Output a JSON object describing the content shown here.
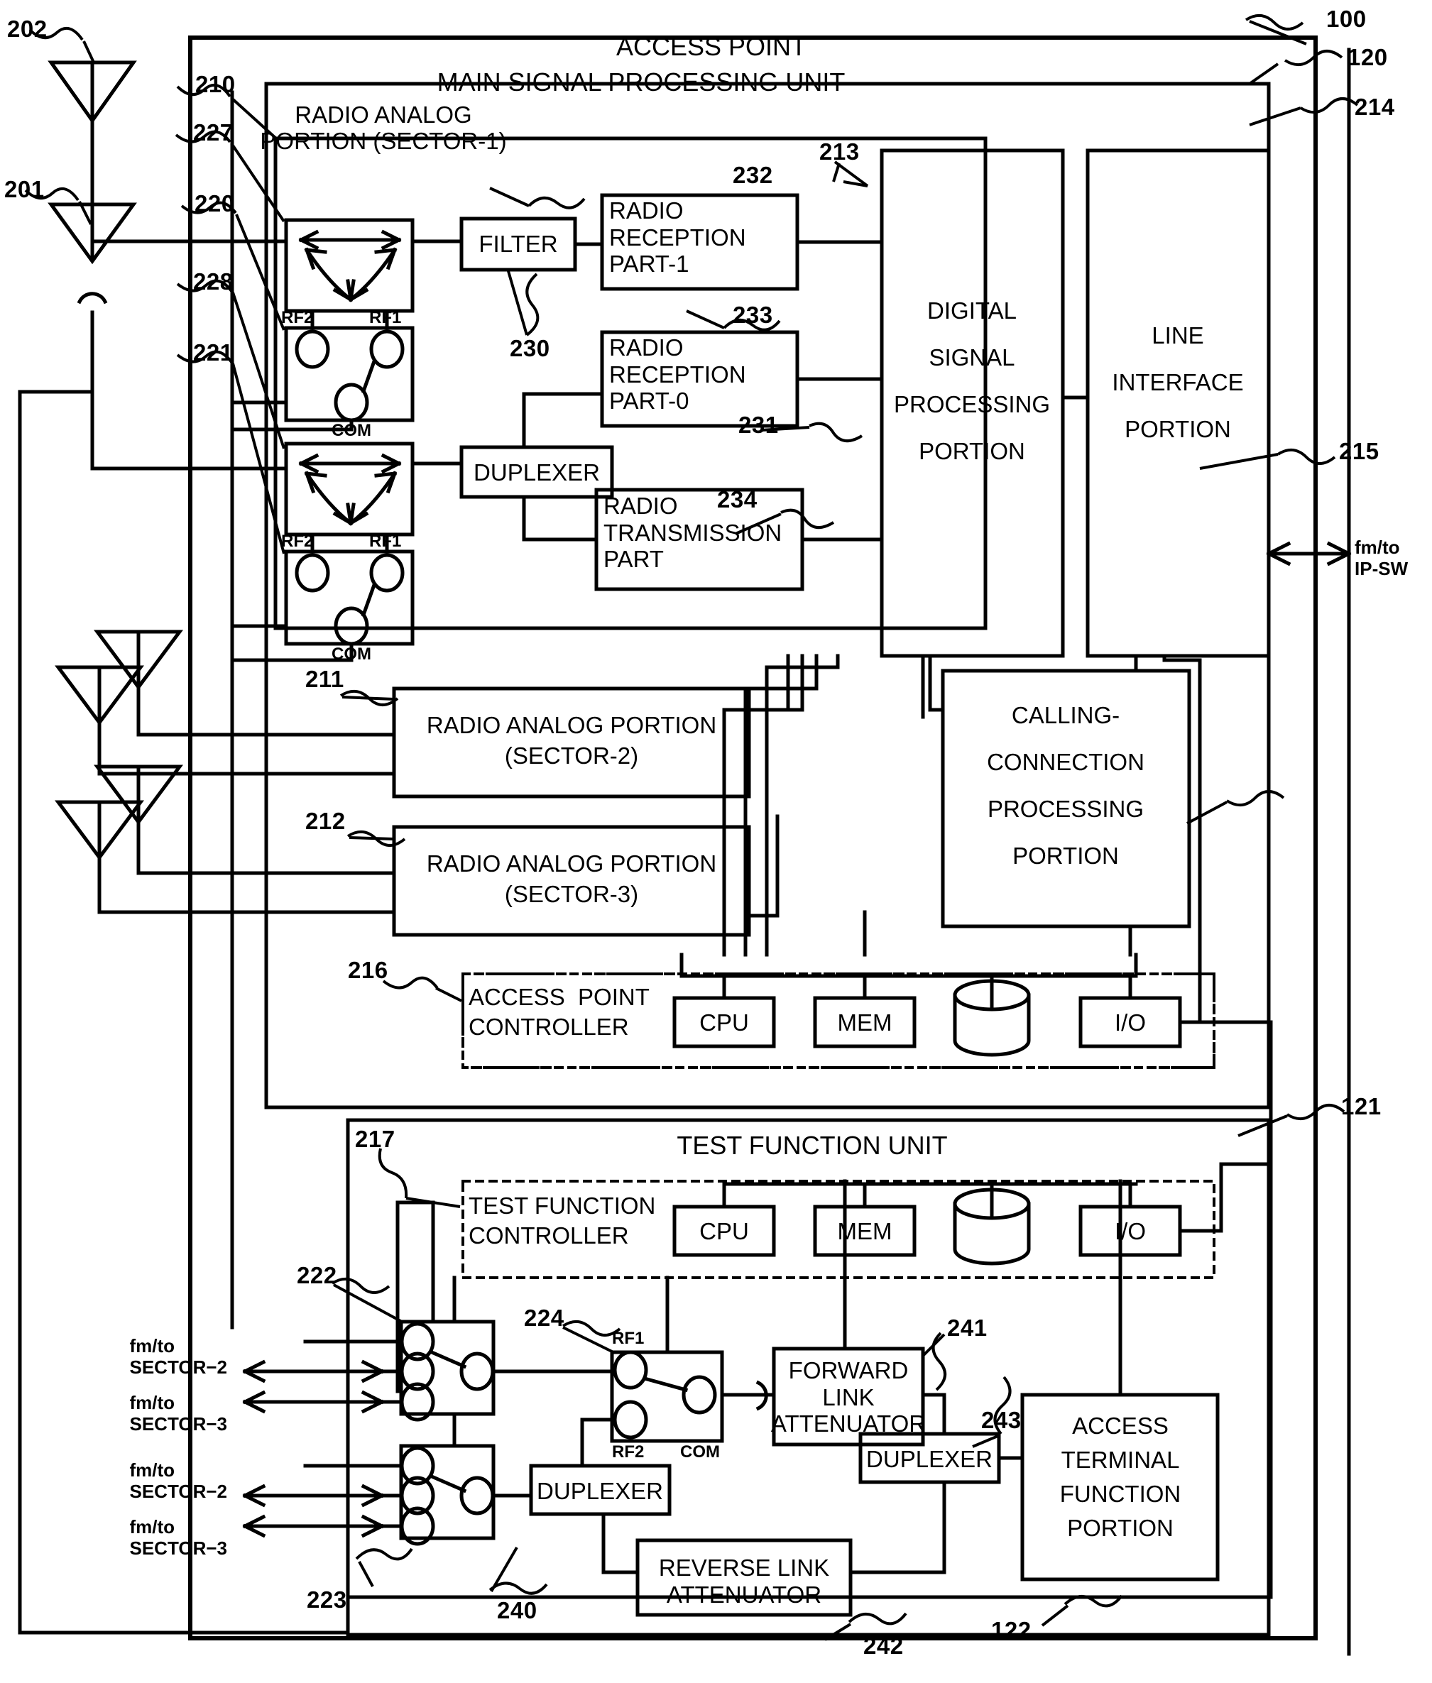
{
  "figure": {
    "type": "patent-block-diagram",
    "title": "ACCESS POINT",
    "reference_numerals": {
      "system": "100",
      "main_signal_processing_unit": "120",
      "test_function_unit": "121",
      "access_terminal_function_portion": "122"
    }
  },
  "units": {
    "access_point": "ACCESS POINT",
    "main_signal_processing_unit": "MAIN SIGNAL PROCESSING UNIT",
    "test_function_unit": "TEST FUNCTION UNIT"
  },
  "antennas": [
    {
      "ref": "202",
      "name": "antenna-202"
    },
    {
      "ref": "201",
      "name": "antenna-201"
    }
  ],
  "blocks": {
    "radio_analog_sector1": {
      "ref": "210",
      "line1": "RADIO ANALOG",
      "line2": "PORTION (SECTOR-1)"
    },
    "coupler_227": {
      "ref": "227"
    },
    "switch_220": {
      "ref": "220",
      "rf2": "RF2",
      "rf1": "RF1",
      "com": "COM"
    },
    "coupler_228": {
      "ref": "228"
    },
    "switch_221": {
      "ref": "221",
      "rf2": "RF2",
      "rf1": "RF1",
      "com": "COM"
    },
    "filter": {
      "ref": "230",
      "label": "FILTER"
    },
    "duplexer_231": {
      "ref": "231",
      "label": "DUPLEXER"
    },
    "radio_reception_part1": {
      "ref": "232",
      "label": "RADIO\nRECEPTION\nPART-1"
    },
    "radio_reception_part0": {
      "ref": "233",
      "label": "RADIO\nRECEPTION\nPART-0"
    },
    "radio_transmission_part": {
      "ref": "234",
      "label": "RADIO\nTRANSMISSION\nPART"
    },
    "digital_signal_processing_portion": {
      "ref": "213",
      "label": "DIGITAL\nSIGNAL\nPROCESSING\nPORTION"
    },
    "line_interface_portion": {
      "ref": "214",
      "label": "LINE\nINTERFACE\nPORTION"
    },
    "calling_connection_processing_portion": {
      "ref": "215",
      "label": "CALLING-\nCONNECTION\nPROCESSING\nPORTION"
    },
    "radio_analog_sector2": {
      "ref": "211",
      "line1": "RADIO ANALOG PORTION",
      "line2": "(SECTOR-2)"
    },
    "radio_analog_sector3": {
      "ref": "212",
      "line1": "RADIO ANALOG PORTION",
      "line2": "(SECTOR-3)"
    },
    "access_point_controller": {
      "ref": "216",
      "line1": "ACCESS  POINT",
      "line2": "CONTROLLER"
    },
    "test_function_controller": {
      "ref": "217",
      "line1": "TEST FUNCTION",
      "line2": "CONTROLLER"
    },
    "switch_222": {
      "ref": "222"
    },
    "switch_223": {
      "ref": "223"
    },
    "switch_224": {
      "ref": "224",
      "rf1": "RF1",
      "rf2": "RF2",
      "com": "COM"
    },
    "duplexer_240": {
      "ref": "240",
      "label": "DUPLEXER"
    },
    "forward_link_attenuator": {
      "ref": "241",
      "label": "FORWARD\nLINK\nATTENUATOR"
    },
    "reverse_link_attenuator": {
      "ref": "242",
      "label": "REVERSE LINK\nATTENUATOR"
    },
    "duplexer_243": {
      "ref": "243",
      "label": "DUPLEXER"
    },
    "access_terminal_function_portion": {
      "ref": "122",
      "label": "ACCESS\nTERMINAL\nFUNCTION\nPORTION"
    }
  },
  "controller_parts": {
    "cpu": "CPU",
    "mem": "MEM",
    "io": "I/O"
  },
  "io_labels": {
    "ip_sw": "fm/to\nIP-SW",
    "sector2_a": "fm/to\nSECTOR−2",
    "sector3_a": "fm/to\nSECTOR−3",
    "sector2_b": "fm/to\nSECTOR−2",
    "sector3_b": "fm/to\nSECTOR−3"
  },
  "colors": {
    "line": "#000000",
    "background": "#ffffff"
  }
}
